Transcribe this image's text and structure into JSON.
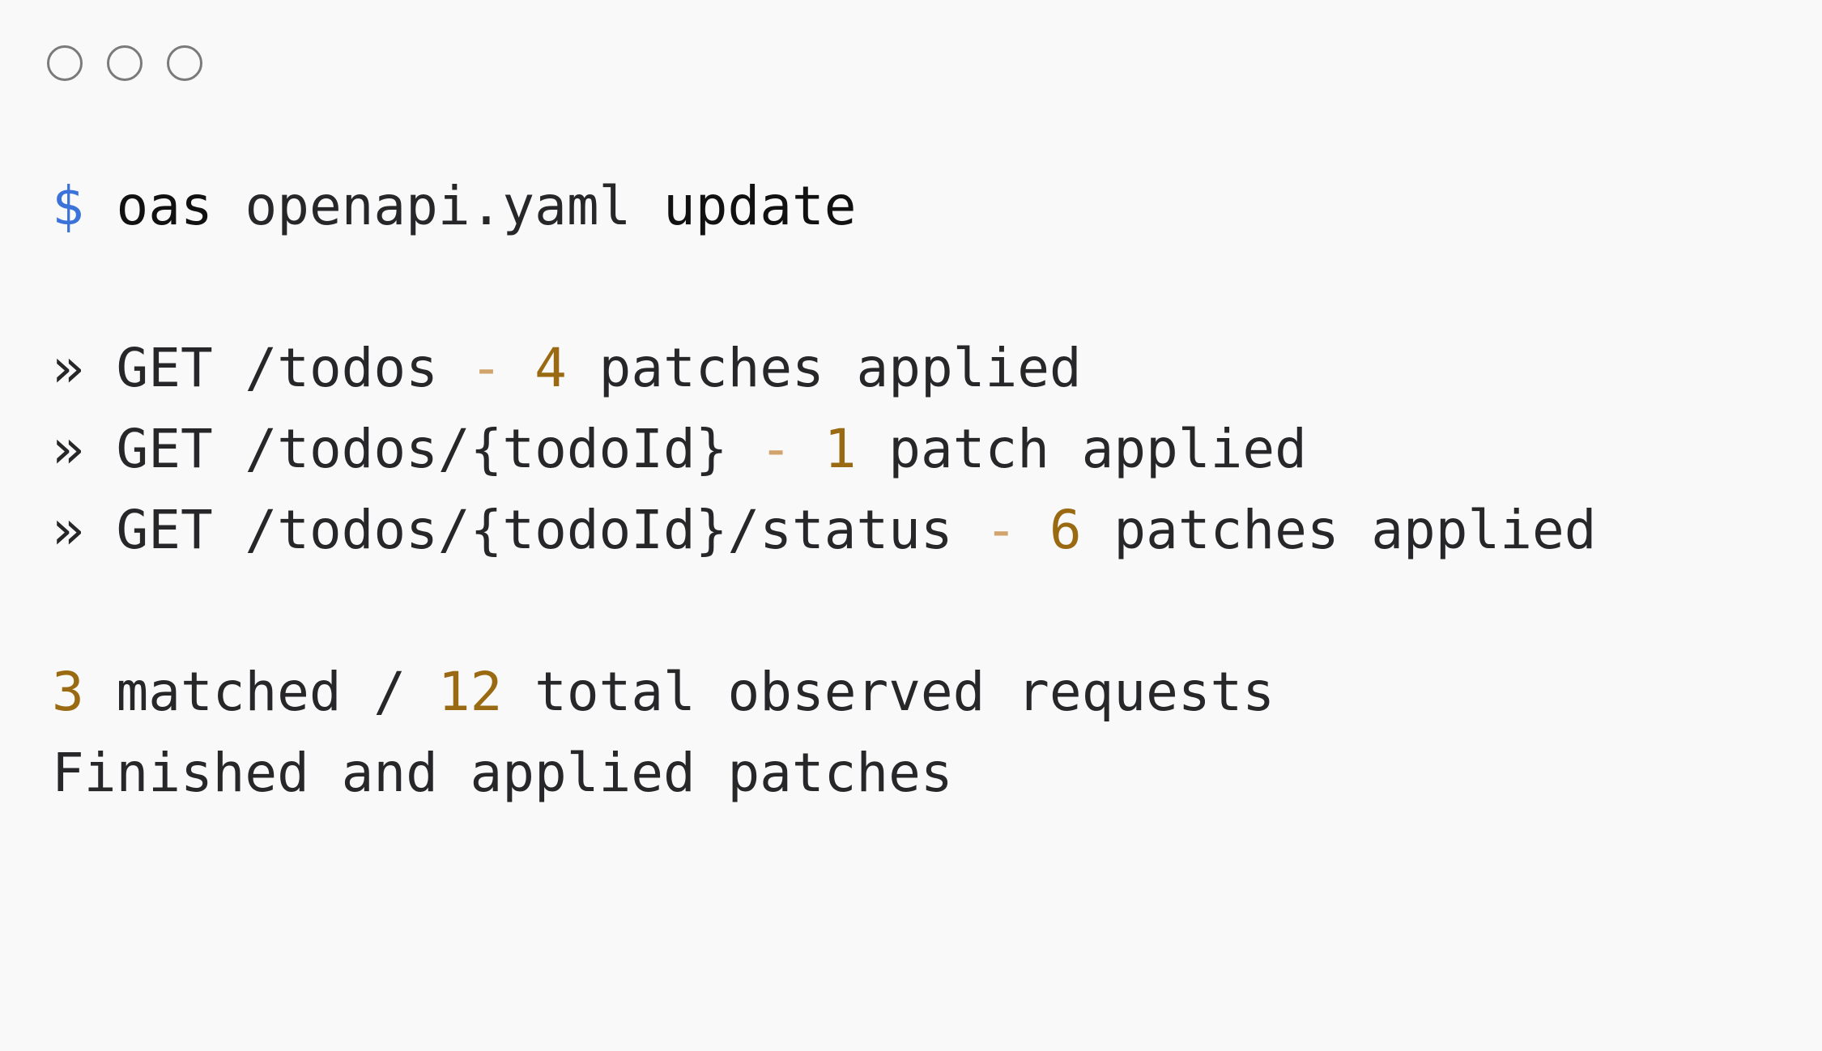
{
  "window": {
    "controls": [
      "close-circle-icon",
      "minimize-circle-icon",
      "maximize-circle-icon"
    ]
  },
  "command": {
    "prompt": "$",
    "program": "oas",
    "file": "openapi.yaml",
    "action": "update"
  },
  "results": [
    {
      "bullet": "»",
      "method": "GET",
      "path": "/todos",
      "sep": "-",
      "count": "4",
      "label": "patches applied"
    },
    {
      "bullet": "»",
      "method": "GET",
      "path": "/todos/{todoId}",
      "sep": "-",
      "count": "1",
      "label": "patch applied"
    },
    {
      "bullet": "»",
      "method": "GET",
      "path": "/todos/{todoId}/status",
      "sep": "-",
      "count": "6",
      "label": "patches applied"
    }
  ],
  "summary": {
    "matched": "3",
    "matched_label": "matched /",
    "total": "12",
    "total_label": "total observed requests",
    "finished": "Finished and applied patches"
  },
  "colors": {
    "background": "#f9f9f9",
    "prompt": "#3b73d9",
    "number": "#9a6a12",
    "dash": "#d0a46c",
    "text": "#27272a"
  }
}
